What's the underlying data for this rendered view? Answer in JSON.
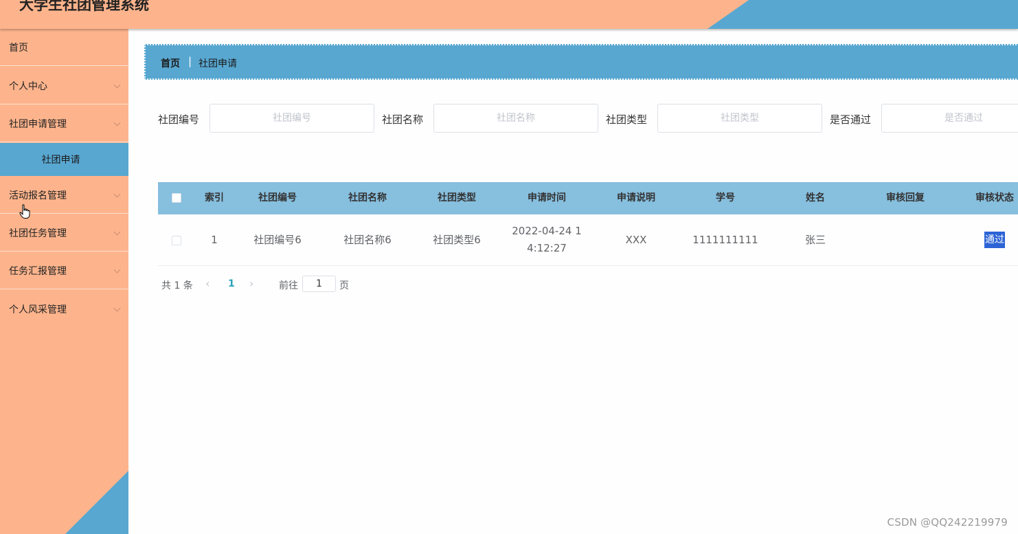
{
  "header": {
    "title": "大学生社团管理系统"
  },
  "sidebar": {
    "items": [
      {
        "label": "首页"
      },
      {
        "label": "个人中心"
      },
      {
        "label": "社团申请管理"
      },
      {
        "label": "社团申请"
      },
      {
        "label": "活动报名管理"
      },
      {
        "label": "社团任务管理"
      },
      {
        "label": "任务汇报管理"
      },
      {
        "label": "个人风采管理"
      }
    ]
  },
  "breadcrumb": {
    "home": "首页",
    "separator": "|",
    "current": "社团申请"
  },
  "search": {
    "fields": [
      {
        "label": "社团编号",
        "placeholder": "社团编号"
      },
      {
        "label": "社团名称",
        "placeholder": "社团名称"
      },
      {
        "label": "社团类型",
        "placeholder": "社团类型"
      },
      {
        "label": "是否通过",
        "placeholder": "是否通过"
      }
    ]
  },
  "table": {
    "columns": [
      "索引",
      "社团编号",
      "社团名称",
      "社团类型",
      "申请时间",
      "申请说明",
      "学号",
      "姓名",
      "审核回复",
      "审核状态"
    ],
    "rows": [
      {
        "index": "1",
        "club_no": "社团编号6",
        "club_name": "社团名称6",
        "club_type": "社团类型6",
        "apply_time_1": "2022-04-24 1",
        "apply_time_2": "4:12:27",
        "description": "XXX",
        "student_no": "1111111111",
        "name": "张三",
        "reply": "",
        "status": "通过"
      }
    ]
  },
  "pagination": {
    "total": "共 1 条",
    "prev": "‹",
    "current_page": "1",
    "next": "›",
    "goto_label": "前往",
    "goto_value": "1",
    "page_unit": "页"
  },
  "watermark": "CSDN @QQ242219979",
  "colors": {
    "peach": "#fdb48c",
    "blue": "#58a7d1",
    "table_header": "#87bfde",
    "status_highlight": "#2c64d6"
  }
}
